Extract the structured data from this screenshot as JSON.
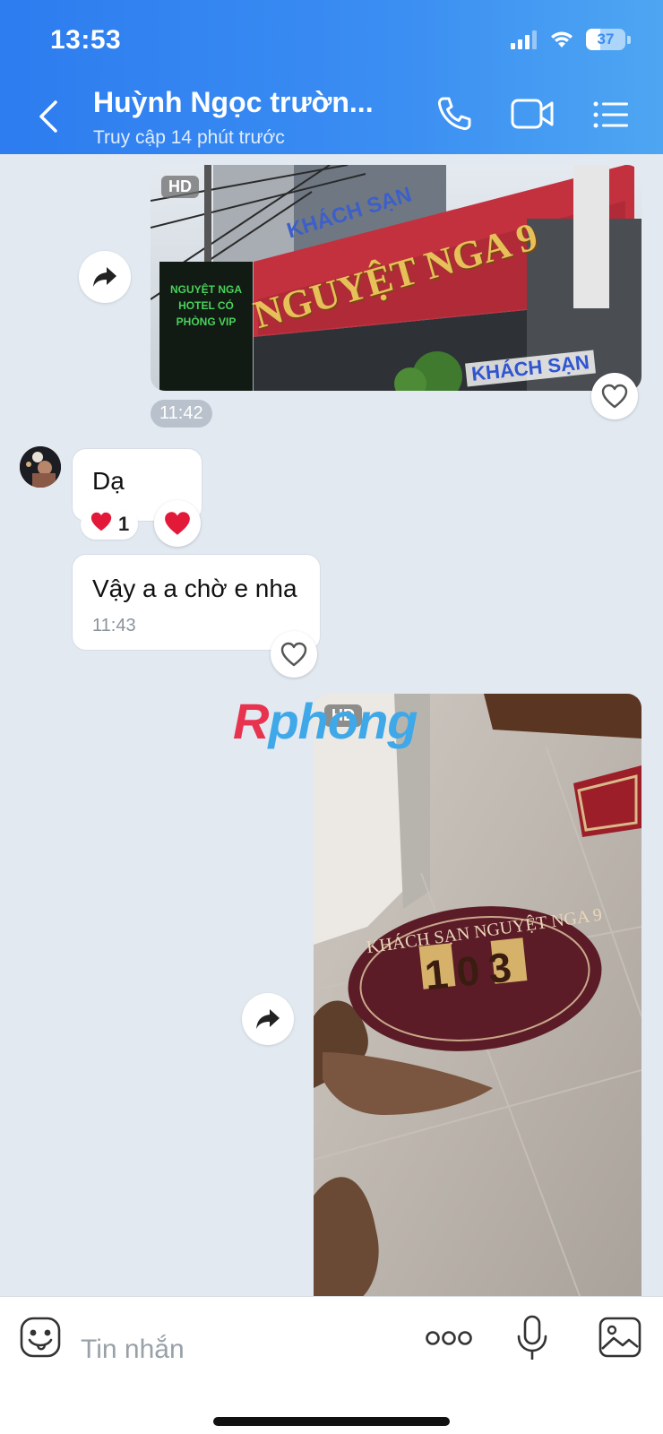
{
  "status_bar": {
    "time": "13:53",
    "battery": "37",
    "battery_level": 0.37
  },
  "header": {
    "contact_name": "Huỳnh Ngọc trườn...",
    "presence": "Truy cập 14 phút trước",
    "icons": [
      "back-icon",
      "phone-icon",
      "video-call-icon",
      "menu-icon"
    ]
  },
  "messages": {
    "photo1": {
      "badge": "HD",
      "time": "11:42",
      "sign_top": "KHÁCH SẠN",
      "sign_main": "NGUYỆT NGA 9",
      "sign_bottom": "KHÁCH SẠN",
      "side_sign": "NGUYỆT NGA HOTEL CÓ PHÒNG VIP"
    },
    "reply1": {
      "text": "Dạ",
      "reaction_count": "1",
      "reaction_emoji": "❤️"
    },
    "reply2": {
      "text": "Vậy a a chờ e nha",
      "time": "11:43"
    },
    "photo2": {
      "badge": "HD",
      "tag_title": "KHÁCH SẠN NGUYỆT NGA 9",
      "tag_number": "103"
    }
  },
  "watermark": {
    "first": "R",
    "rest": "phong"
  },
  "composer": {
    "placeholder": "Tin nhắn",
    "icons": [
      "emoji-icon",
      "more-icon",
      "mic-icon",
      "image-icon"
    ]
  },
  "colors": {
    "header_start": "#2d7cf0",
    "header_end": "#4ea6f2",
    "chat_bg": "#e2e9f1",
    "heart": "#e3193a"
  }
}
